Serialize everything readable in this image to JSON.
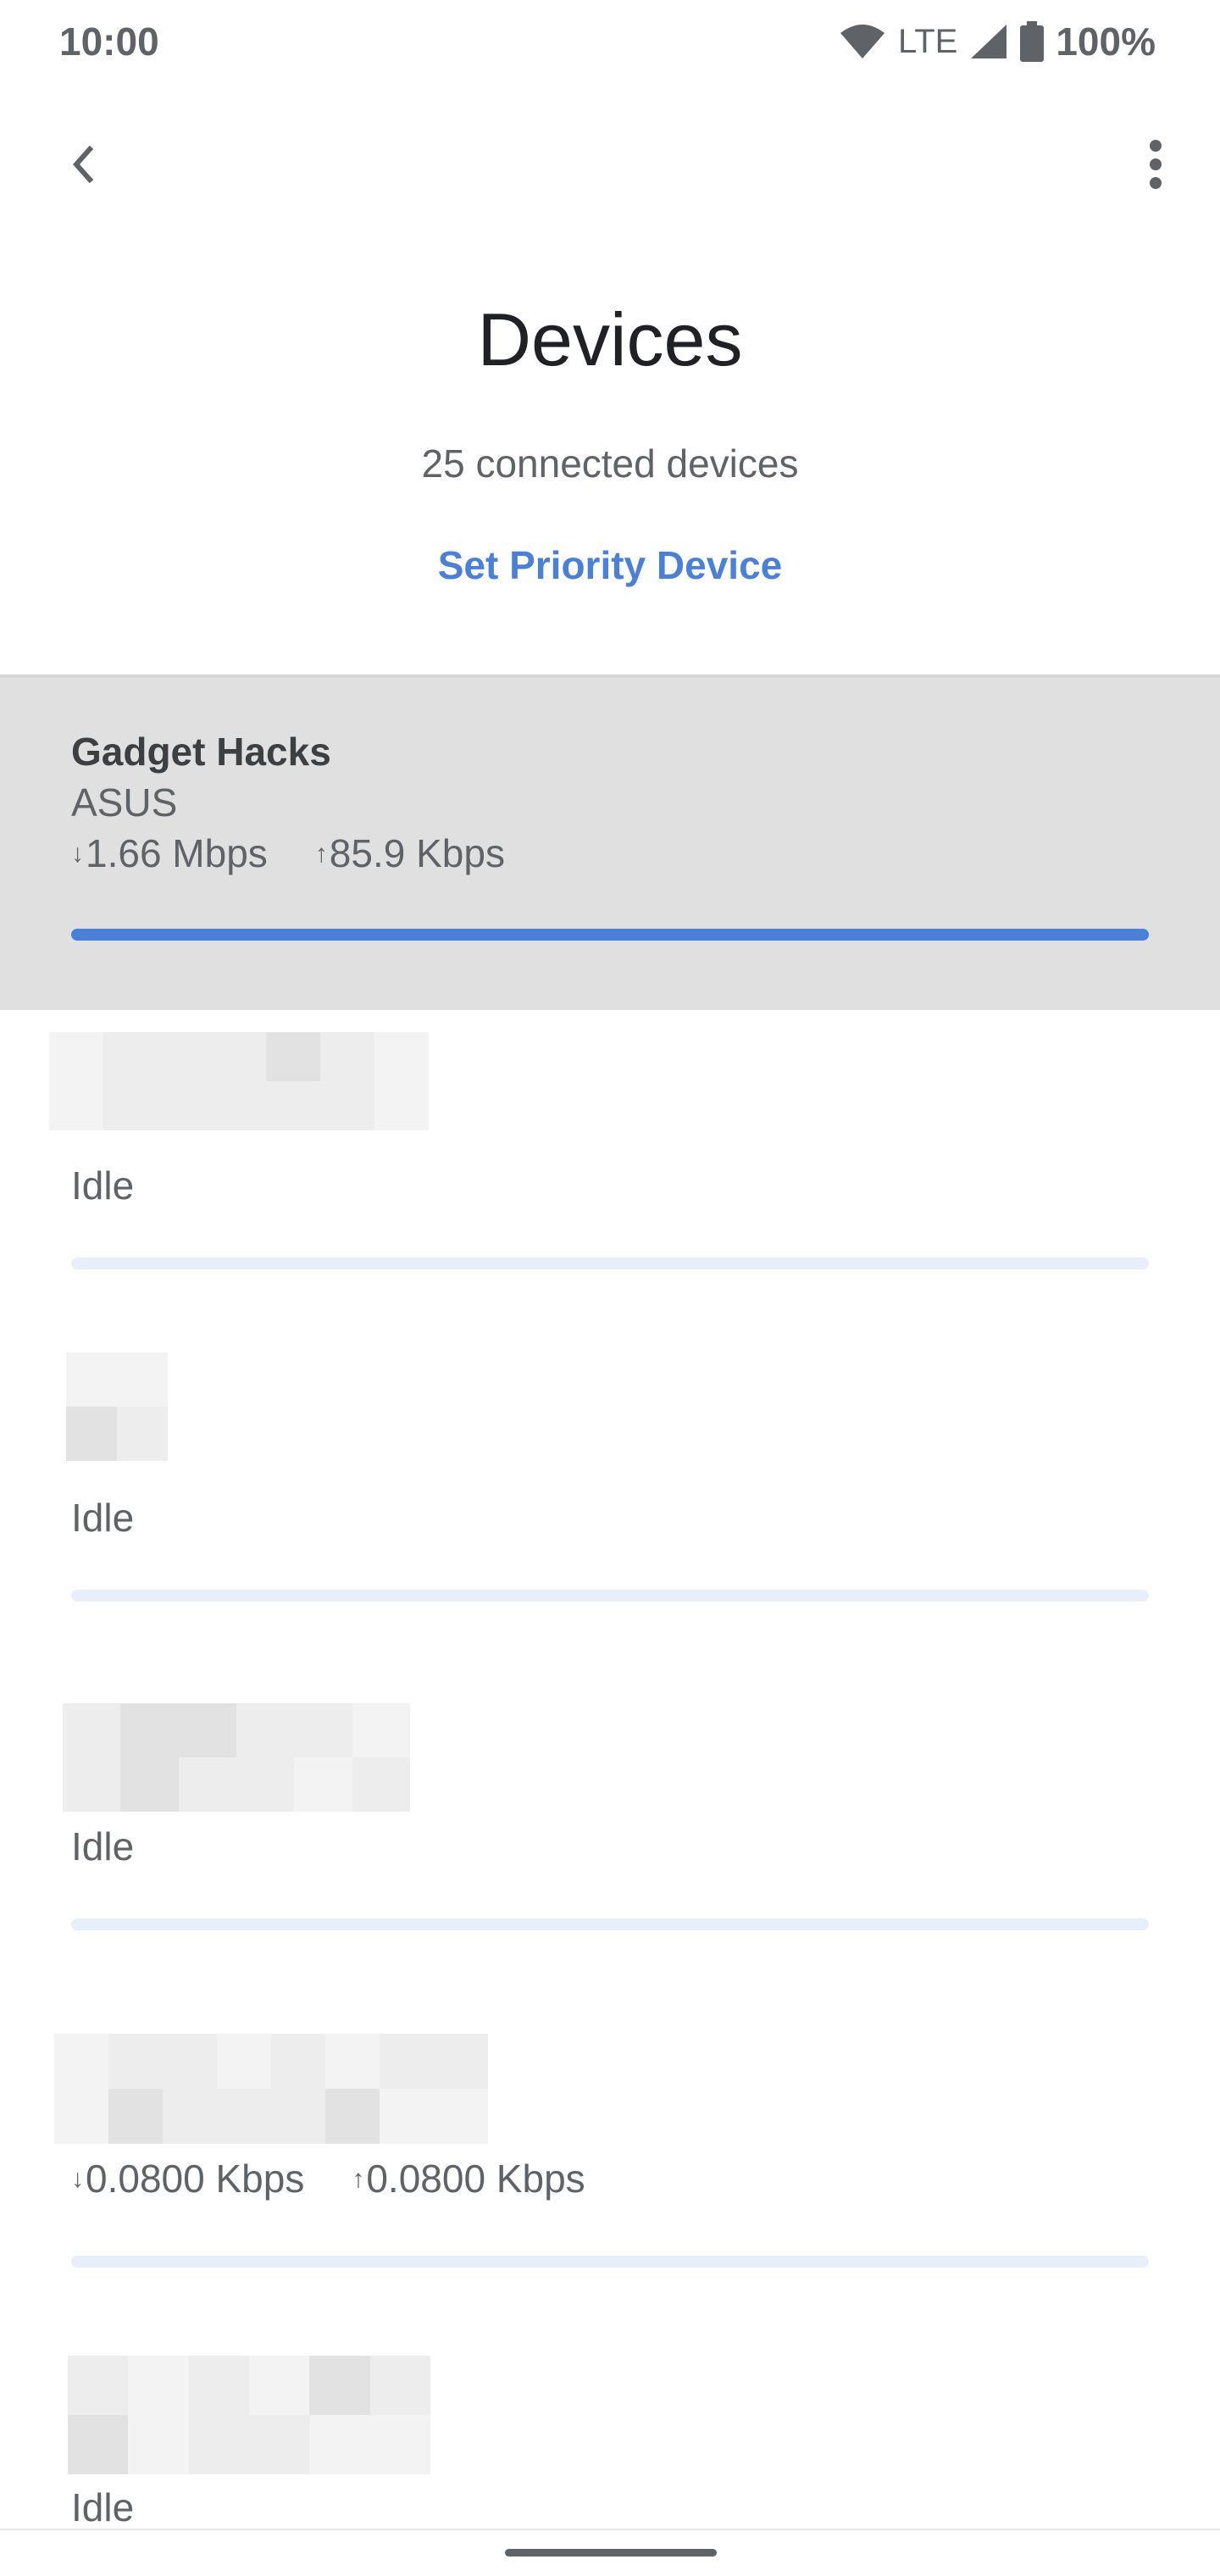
{
  "status_bar": {
    "time": "10:00",
    "network": "LTE",
    "battery": "100%",
    "icons": [
      "wifi-icon",
      "cell-signal-icon",
      "battery-icon"
    ]
  },
  "app_bar": {
    "back_icon": "chevron-left-icon",
    "menu_icon": "more-vert-icon"
  },
  "header": {
    "title": "Devices",
    "subtitle": "25 connected devices",
    "priority_link": "Set Priority Device"
  },
  "colors": {
    "accent": "#4a80d8",
    "highlight_bg": "#e0e0e0",
    "bar_track": "#e8effb"
  },
  "devices": [
    {
      "name": "Gadget Hacks",
      "maker": "ASUS",
      "down": "1.66 Mbps",
      "up": "85.9 Kbps",
      "usage_fraction": 1.0,
      "highlighted": true
    },
    {
      "status": "Idle",
      "usage_fraction": 0.0
    },
    {
      "status": "Idle",
      "usage_fraction": 0.0
    },
    {
      "status": "Idle",
      "usage_fraction": 0.0
    },
    {
      "down": "0.0800 Kbps",
      "up": "0.0800 Kbps",
      "usage_fraction": 0.0
    },
    {
      "status": "Idle",
      "usage_fraction": 0.0
    }
  ]
}
